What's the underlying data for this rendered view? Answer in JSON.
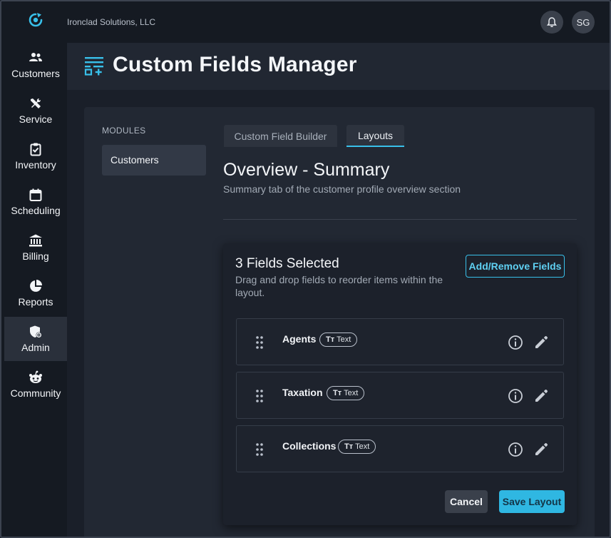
{
  "app": {
    "company_name": "Ironclad Solutions, LLC",
    "user_initials": "SG",
    "accent_color": "#38c0ea"
  },
  "nav": {
    "items": [
      {
        "label": "Customers",
        "icon": "people-icon",
        "active": false
      },
      {
        "label": "Service",
        "icon": "tools-icon",
        "active": false
      },
      {
        "label": "Inventory",
        "icon": "clipboard-check-icon",
        "active": false
      },
      {
        "label": "Scheduling",
        "icon": "calendar-icon",
        "active": false
      },
      {
        "label": "Billing",
        "icon": "bank-icon",
        "active": false
      },
      {
        "label": "Reports",
        "icon": "pie-chart-icon",
        "active": false
      },
      {
        "label": "Admin",
        "icon": "shield-gear-icon",
        "active": true
      },
      {
        "label": "Community",
        "icon": "community-icon",
        "active": false
      }
    ]
  },
  "page": {
    "title": "Custom Fields Manager",
    "title_icon": "custom-fields-icon"
  },
  "modules": {
    "heading": "MODULES",
    "items": [
      {
        "label": "Customers",
        "selected": true
      }
    ]
  },
  "tabs": [
    {
      "label": "Custom Field Builder",
      "active": false
    },
    {
      "label": "Layouts",
      "active": true
    }
  ],
  "section": {
    "title": "Overview - Summary",
    "subtitle": "Summary tab of the customer profile overview section"
  },
  "card": {
    "title": "3 Fields Selected",
    "description": "Drag and drop fields to reorder items within the layout.",
    "add_button": "Add/Remove Fields",
    "cancel_button": "Cancel",
    "save_button": "Save Layout"
  },
  "fields": [
    {
      "name": "Agents",
      "type_glyph": "Tт",
      "type": "Text"
    },
    {
      "name": "Taxation",
      "type_glyph": "Tт",
      "type": "Text"
    },
    {
      "name": "Collections",
      "type_glyph": "Tт",
      "type": "Text"
    }
  ]
}
